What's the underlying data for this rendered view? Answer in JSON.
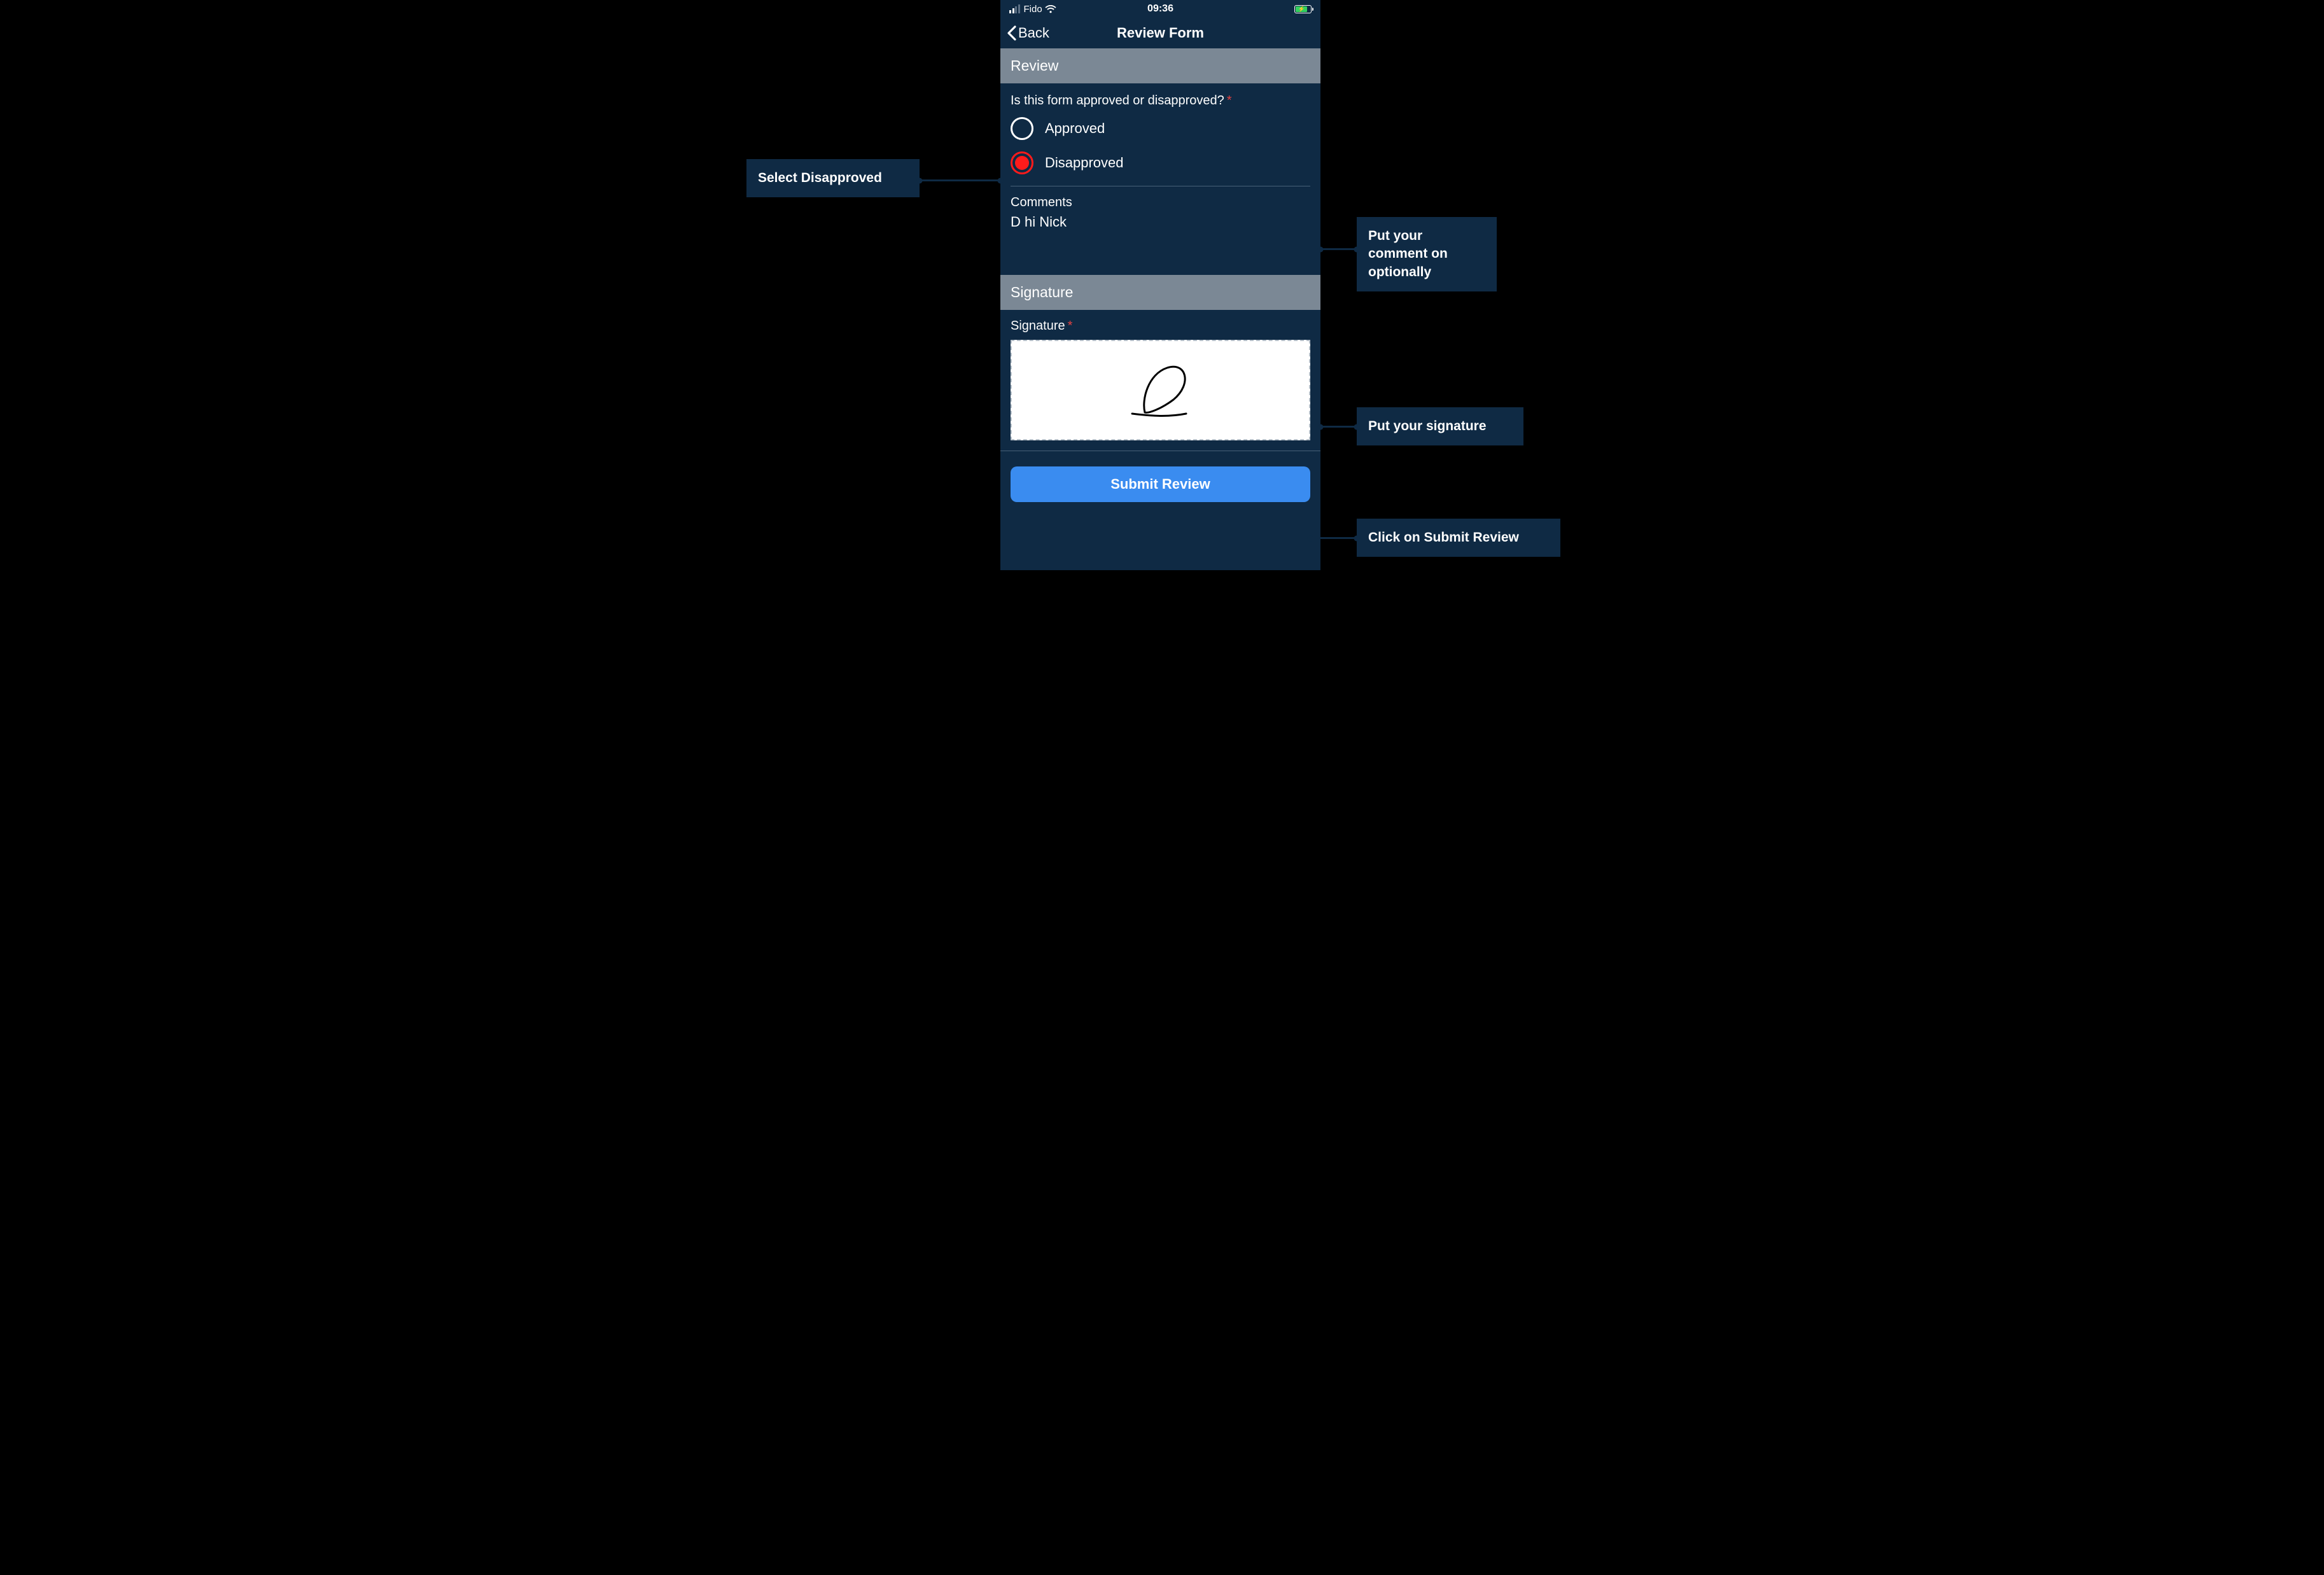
{
  "statusBar": {
    "carrier": "Fido",
    "time": "09:36"
  },
  "nav": {
    "back": "Back",
    "title": "Review Form"
  },
  "sections": {
    "review": {
      "header": "Review",
      "question": "Is this form approved or disapproved?",
      "options": {
        "approved": "Approved",
        "disapproved": "Disapproved"
      },
      "commentsLabel": "Comments",
      "commentsValue": "D hi Nick"
    },
    "signature": {
      "header": "Signature",
      "label": "Signature"
    }
  },
  "submit": {
    "label": "Submit Review"
  },
  "callouts": {
    "disapproved": "Select Disapproved",
    "comment": "Put your comment on optionally",
    "signature": "Put your signature",
    "submit": "Click on Submit Review"
  }
}
